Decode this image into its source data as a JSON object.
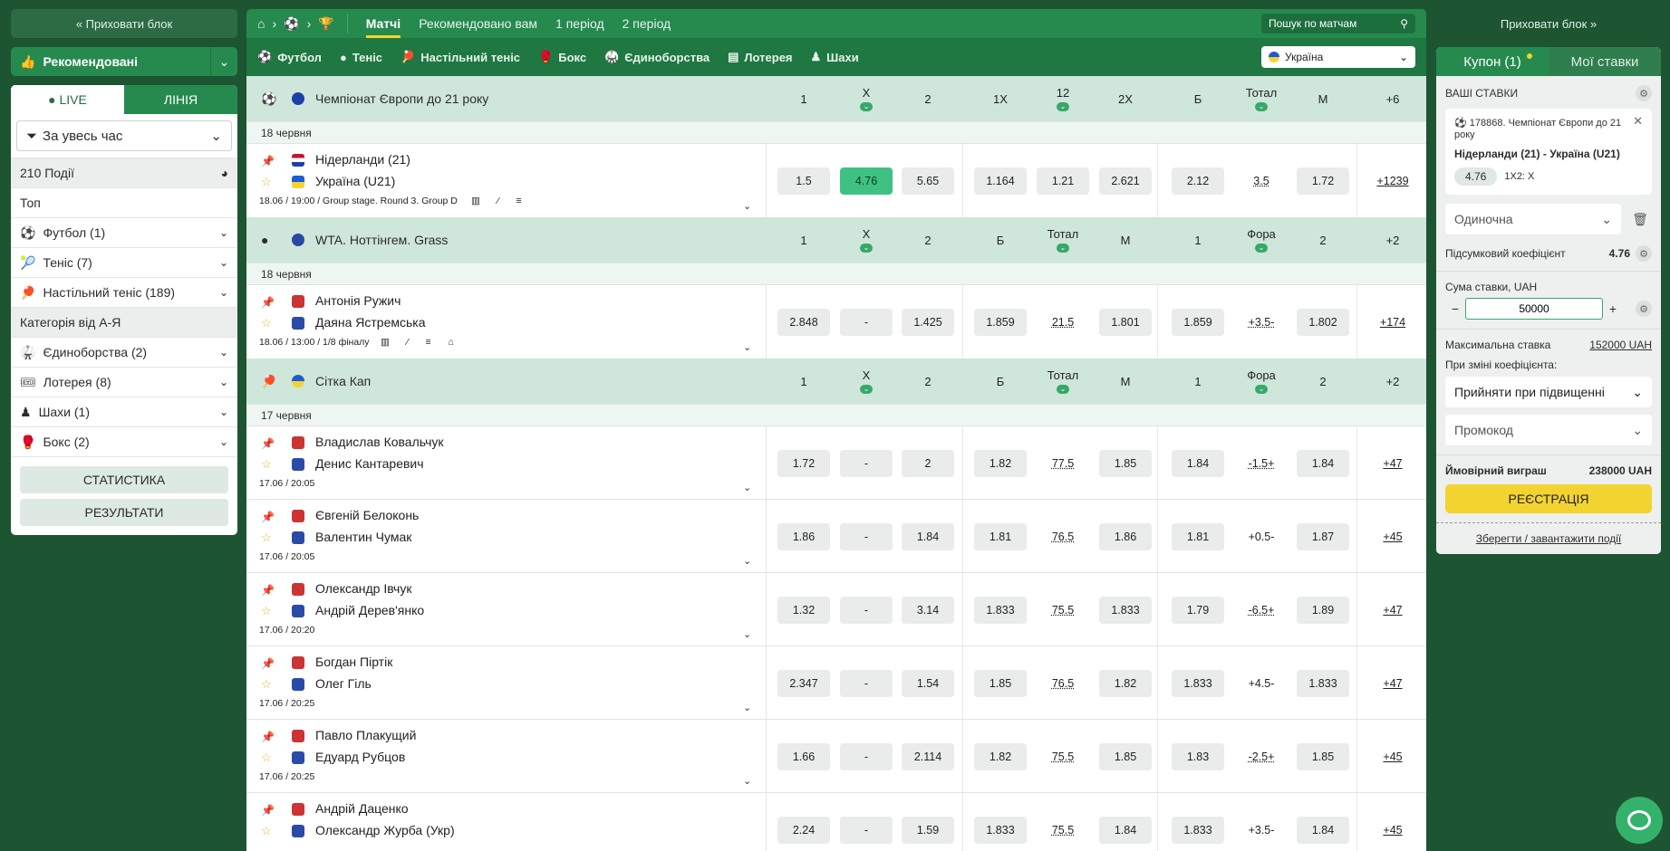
{
  "left": {
    "hide_label": "« Приховати блок",
    "recommended": "Рекомендовані",
    "tab_live": "● LIVE",
    "tab_line": "ЛІНІЯ",
    "filter": "За увесь час",
    "events": "210 Події",
    "top": "Топ",
    "sports": [
      {
        "label": "Футбол (1)",
        "icon": "⚽"
      },
      {
        "label": "Теніс (7)",
        "icon": "🎾"
      },
      {
        "label": "Настільний теніс (189)",
        "icon": "🏓"
      }
    ],
    "category": "Категорія від А-Я",
    "categories": [
      {
        "label": "Єдиноборства (2)",
        "icon": "🥋"
      },
      {
        "label": "Лотерея (8)",
        "icon": "🎟"
      },
      {
        "label": "Шахи (1)",
        "icon": "♟"
      },
      {
        "label": "Бокс (2)",
        "icon": "🥊"
      }
    ],
    "stats_btn": "СТАТИСТИКА",
    "results_btn": "РЕЗУЛЬТАТИ"
  },
  "top": {
    "tabs": [
      "Матчі",
      "Рекомендовано вам",
      "1 період",
      "2 період"
    ],
    "search_placeholder": "Пошук по матчам",
    "sports": [
      "Футбол",
      "Теніс",
      "Настільний теніс",
      "Бокс",
      "Єдиноборства",
      "Лотерея",
      "Шахи"
    ],
    "country": "Україна"
  },
  "leagues": [
    {
      "name": "Чемпіонат Європи до 21 року",
      "headers": [
        "1",
        "X",
        "2",
        "1X",
        "12",
        "2X",
        "Б",
        "Тотал",
        "М",
        "+6"
      ],
      "date": "18 червня",
      "matches": [
        {
          "t1": "Нідерланди (21)",
          "t2": "Україна (U21)",
          "info": "18.06 / 19:00 / Group stage. Round 3. Group D",
          "odds": [
            "1.5",
            "4.76",
            "5.65",
            "1.164",
            "1.21",
            "2.621",
            "2.12",
            "3.5",
            "1.72"
          ],
          "more": "+1239"
        }
      ]
    },
    {
      "name": "WTA. Ноттінгем. Grass",
      "headers": [
        "1",
        "X",
        "2",
        "Б",
        "Тотал",
        "М",
        "1",
        "Фора",
        "2",
        "+2"
      ],
      "date": "18 червня",
      "matches": [
        {
          "t1": "Антонія Ружич",
          "t2": "Даяна Ястремська",
          "info": "18.06 / 13:00 / 1/8 фіналу",
          "odds": [
            "2.848",
            "-",
            "1.425",
            "1.859",
            "21.5",
            "1.801",
            "1.859",
            "+3.5-",
            "1.802"
          ],
          "more": "+174"
        }
      ]
    },
    {
      "name": "Сітка Кап",
      "headers": [
        "1",
        "X",
        "2",
        "Б",
        "Тотал",
        "М",
        "1",
        "Фора",
        "2",
        "+2"
      ],
      "date": "17 червня",
      "matches": [
        {
          "t1": "Владислав Ковальчук",
          "t2": "Денис Кантаревич",
          "info": "17.06 / 20:05",
          "odds": [
            "1.72",
            "-",
            "2",
            "1.82",
            "77.5",
            "1.85",
            "1.84",
            "-1.5+",
            "1.84"
          ],
          "more": "+47"
        },
        {
          "t1": "Євгеній Белоконь",
          "t2": "Валентин Чумак",
          "info": "17.06 / 20:05",
          "odds": [
            "1.86",
            "-",
            "1.84",
            "1.81",
            "76.5",
            "1.86",
            "1.81",
            "+0.5-",
            "1.87"
          ],
          "more": "+45"
        },
        {
          "t1": "Олександр Івчук",
          "t2": "Андрій Дерев'янко",
          "info": "17.06 / 20:20",
          "odds": [
            "1.32",
            "-",
            "3.14",
            "1.833",
            "75.5",
            "1.833",
            "1.79",
            "-6.5+",
            "1.89"
          ],
          "more": "+47"
        },
        {
          "t1": "Богдан Піртік",
          "t2": "Олег Гіль",
          "info": "17.06 / 20:25",
          "odds": [
            "2.347",
            "-",
            "1.54",
            "1.85",
            "76.5",
            "1.82",
            "1.833",
            "+4.5-",
            "1.833"
          ],
          "more": "+47"
        },
        {
          "t1": "Павло Плакущий",
          "t2": "Едуард Рубцов",
          "info": "17.06 / 20:25",
          "odds": [
            "1.66",
            "-",
            "2.114",
            "1.82",
            "75.5",
            "1.85",
            "1.83",
            "-2.5+",
            "1.85"
          ],
          "more": "+45"
        },
        {
          "t1": "Андрій Даценко",
          "t2": "Олександр Журба (Укр)",
          "info": "",
          "odds": [
            "2.24",
            "-",
            "1.59",
            "1.833",
            "75.5",
            "1.84",
            "1.833",
            "+3.5-",
            "1.84"
          ],
          "more": "+45"
        }
      ]
    }
  ],
  "right": {
    "hide_label": "Приховати блок »",
    "tab_coupon": "Купон (1)",
    "tab_mybets": "Мої ставки",
    "your_bets": "ВАШІ СТАВКИ",
    "bet_event": "178868. Чемпіонат Європи до 21 року",
    "bet_match": "Нідерланди (21) - Україна (U21)",
    "bet_odd": "4.76",
    "bet_market": "1X2: X",
    "bet_type": "Одиночна",
    "total_coef_label": "Підсумковий коефіцієнт",
    "total_coef": "4.76",
    "stake_label": "Сума ставки, UAH",
    "stake_value": "50000",
    "max_label": "Максимальна ставка",
    "max_value": "152000 UAH",
    "change_label": "При зміні коефіцієнта:",
    "change_value": "Прийняти при підвищенні",
    "promo": "Промокод",
    "win_label": "Ймовірний виграш",
    "win_value": "238000 UAH",
    "register": "РЕЄСТРАЦІЯ",
    "save_load": "Зберегти / завантажити події"
  }
}
